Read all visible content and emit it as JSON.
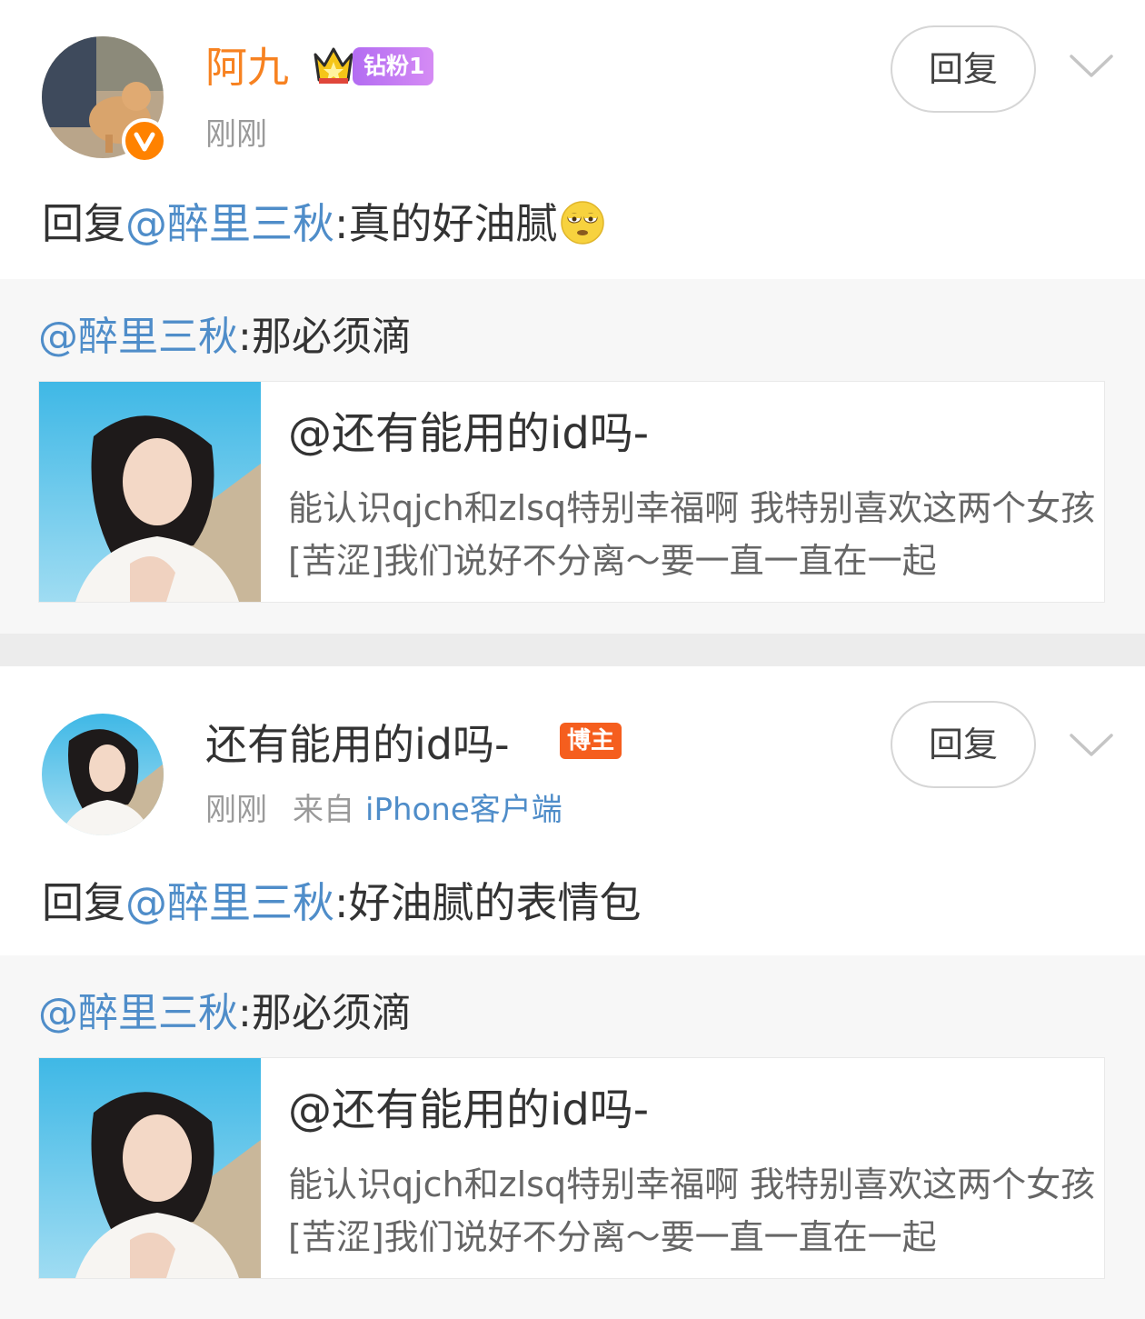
{
  "comments": [
    {
      "user_name": "阿九",
      "fan_badge": "钻粉1",
      "time": "刚刚",
      "reply_button": "回复",
      "reply_prefix": "回复",
      "mention": "@醉里三秋",
      "text": ":真的好油腻",
      "emoji": "rolling-eyes-emoji",
      "quote": {
        "mention": "@醉里三秋",
        "text": ":那必须滴",
        "card_title": "@还有能用的id吗-",
        "card_desc": "能认识qjch和zlsq特别幸福啊 我特别喜欢这两个女孩[苦涩]我们说好不分离～要一直一直在一起"
      }
    },
    {
      "user_name": "还有能用的id吗-",
      "host_badge": "博主",
      "time": "刚刚",
      "source_label": "来自",
      "source": "iPhone客户端",
      "reply_button": "回复",
      "reply_prefix": "回复",
      "mention": "@醉里三秋",
      "text": ":好油腻的表情包",
      "quote": {
        "mention": "@醉里三秋",
        "text": ":那必须滴",
        "card_title": "@还有能用的id吗-",
        "card_desc": "能认识qjch和zlsq特别幸福啊 我特别喜欢这两个女孩[苦涩]我们说好不分离～要一直一直在一起"
      }
    }
  ],
  "colors": {
    "accent_blue": "#4f8dc9",
    "name_orange": "#f78221",
    "fan_badge": "#b36cf2",
    "host_badge": "#f55e1e"
  }
}
